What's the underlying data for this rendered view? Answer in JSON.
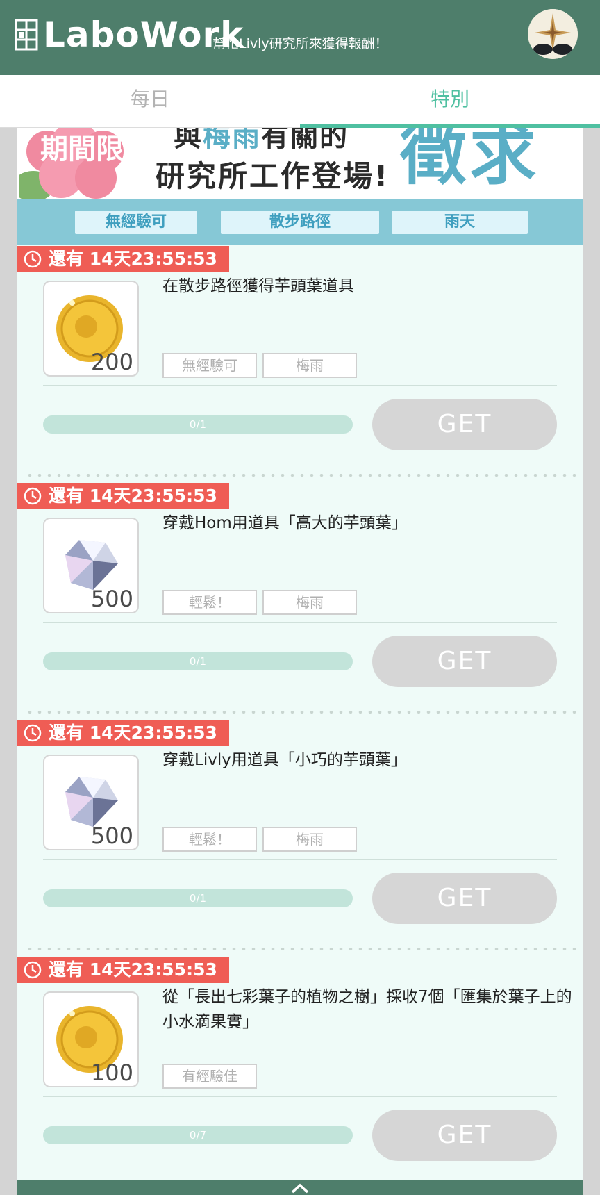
{
  "header": {
    "logo": "LaboWork",
    "subtitle": "幫忙Livly研究所來獲得報酬！"
  },
  "tabs": [
    {
      "label": "每日",
      "active": false
    },
    {
      "label": "特別",
      "active": true
    }
  ],
  "banner": {
    "badge": "期間限定",
    "line1_pre": "與",
    "line1_highlight": "梅雨",
    "line1_post": "有關的",
    "line2": "研究所工作登場!",
    "big": "徵求",
    "tags": [
      "無經驗可",
      "散步路徑",
      "雨天"
    ]
  },
  "quests": [
    {
      "timer": "還有 14天23:55:53",
      "reward_icon": "gold-coin",
      "reward_count": "200",
      "title": "在散步路徑獲得芋頭葉道具",
      "tags": [
        "無經驗可",
        "梅雨"
      ],
      "progress": "0/1",
      "progress_fraction": 0,
      "button": "GET"
    },
    {
      "timer": "還有 14天23:55:53",
      "reward_icon": "diamond",
      "reward_count": "500",
      "title": "穿戴Hom用道具「高大的芋頭葉」",
      "tags": [
        "輕鬆！",
        "梅雨"
      ],
      "progress": "0/1",
      "progress_fraction": 0,
      "button": "GET"
    },
    {
      "timer": "還有 14天23:55:53",
      "reward_icon": "diamond",
      "reward_count": "500",
      "title": "穿戴Livly用道具「小巧的芋頭葉」",
      "tags": [
        "輕鬆！",
        "梅雨"
      ],
      "progress": "0/1",
      "progress_fraction": 0,
      "button": "GET"
    },
    {
      "timer": "還有 14天23:55:53",
      "reward_icon": "gold-coin",
      "reward_count": "100",
      "title": "從「長出七彩葉子的植物之樹」採收7個「匯集於葉子上的小水滴果實」",
      "tags": [
        "有經驗佳"
      ],
      "progress": "0/7",
      "progress_fraction": 0,
      "button": "GET"
    }
  ],
  "colors": {
    "header": "#4e7e6b",
    "accent": "#4fc0a1",
    "timer": "#ef5d55",
    "banner_blue": "#5aaec6",
    "content_bg": "#effbf8",
    "button_disabled": "#d6d6d6"
  }
}
